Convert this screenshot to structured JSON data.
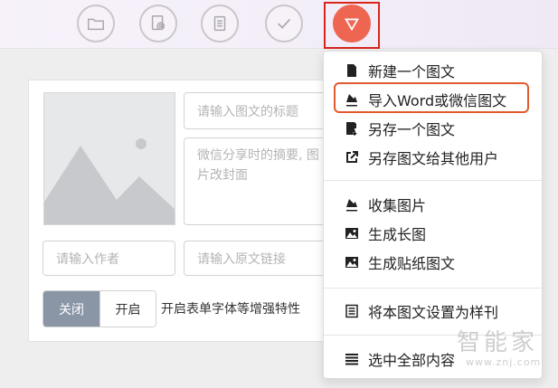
{
  "toolbar": {
    "buttons": [
      {
        "name": "folder-icon"
      },
      {
        "name": "collect-link-icon"
      },
      {
        "name": "clipboard-icon"
      },
      {
        "name": "check-icon"
      },
      {
        "name": "dropdown-triangle-icon"
      }
    ],
    "accent": "#ee6651",
    "highlight_color": "#d8261b"
  },
  "editor": {
    "title_placeholder": "请输入图文的标题",
    "summary_placeholder": "微信分享时的摘要, 图片改封面",
    "author_placeholder": "请输入作者",
    "source_placeholder": "请输入原文链接",
    "toggle_off_label": "关闭",
    "toggle_on_label": "开启",
    "toggle_description": "开启表单字体等增强特性"
  },
  "menu": {
    "items": [
      {
        "label": "新建一个图文",
        "icon": "file-icon"
      },
      {
        "label": "导入Word或微信图文",
        "icon": "import-icon"
      },
      {
        "label": "另存一个图文",
        "icon": "save-as-icon"
      },
      {
        "label": "另存图文给其他用户",
        "icon": "share-icon"
      },
      {
        "label": "收集图片",
        "icon": "collect-image-icon"
      },
      {
        "label": "生成长图",
        "icon": "image-icon"
      },
      {
        "label": "生成贴纸图文",
        "icon": "image-icon"
      },
      {
        "label": "将本图文设置为样刊",
        "icon": "list-icon"
      },
      {
        "label": "选中全部内容",
        "icon": "select-all-icon"
      }
    ],
    "highlight_color": "#e05a2e"
  },
  "watermark": {
    "title": "智能家",
    "url": "www.znj.com"
  }
}
